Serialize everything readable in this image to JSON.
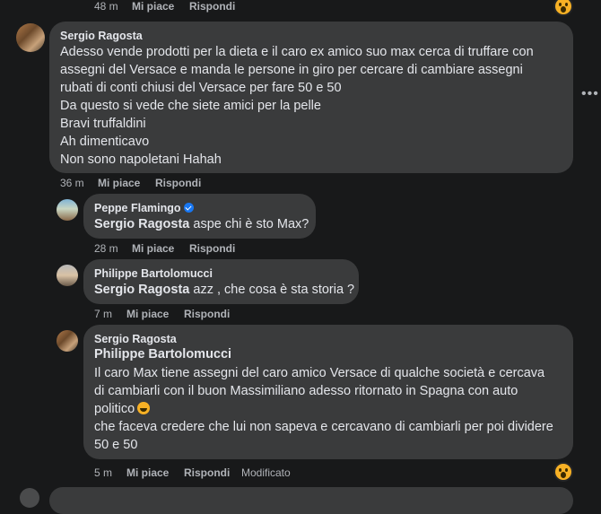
{
  "top_meta": {
    "time": "48 m",
    "like": "Mi piace",
    "reply": "Rispondi"
  },
  "comments": [
    {
      "author": "Sergio Ragosta",
      "lines": [
        "Adesso vende prodotti per la dieta e il caro ex amico suo max cerca di truffare con",
        "assegni del Versace e manda le persone in giro per cercare di cambiare assegni",
        "rubati di conti chiusi del Versace per fare 50 e 50",
        "Da questo si vede che siete amici per la pelle",
        "Bravi truffaldini",
        "Ah dimenticavo",
        "Non sono napoletani Hahah"
      ],
      "time": "36 m",
      "like": "Mi piace",
      "reply": "Rispondi"
    },
    {
      "author": "Peppe Flamingo",
      "mention": "Sergio Ragosta",
      "text": " aspe chi è sto Max?",
      "time": "28 m",
      "like": "Mi piace",
      "reply": "Rispondi"
    },
    {
      "author": "Philippe Bartolomucci",
      "mention": "Sergio Ragosta",
      "text": " azz , che cosa è sta storia ?",
      "time": "7 m",
      "like": "Mi piace",
      "reply": "Rispondi"
    },
    {
      "author": "Sergio Ragosta",
      "mention": "Philippe Bartolomucci",
      "lines": [
        "Il caro Max tiene assegni del caro amico Versace di qualche società e cercava",
        "di cambiarli con il buon Massimiliano adesso ritornato in Spagna con auto",
        "politico",
        "che faceva credere che lui non sapeva e cercavano di cambiarli per poi dividere",
        "50 e 50"
      ],
      "time": "5 m",
      "like": "Mi piace",
      "reply": "Rispondi",
      "edited": "Modificato"
    }
  ],
  "icons": {
    "more": "more-options-icon",
    "reaction": "wow-reaction-icon",
    "laugh": "laughing-emoji-icon",
    "verified": "verified-badge-icon"
  },
  "colors": {
    "background": "#18191a",
    "bubble": "#3a3b3c",
    "meta": "#b0b3b8",
    "verified": "#1877f2"
  }
}
